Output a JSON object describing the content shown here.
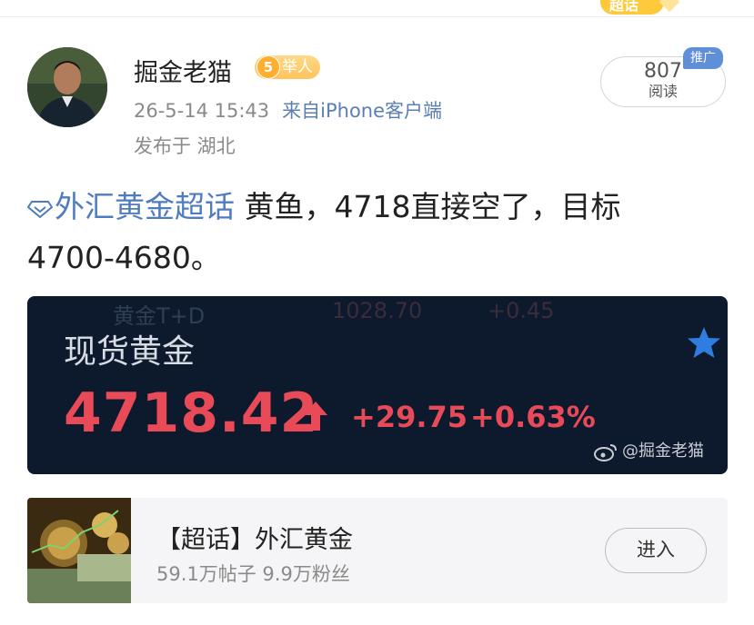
{
  "corner_badge": "超话",
  "user": {
    "name": "掘金老猫",
    "level": "5",
    "badge_label": "举人",
    "timestamp": "26-5-14 15:43",
    "source": "来自iPhone客户端",
    "location": "发布于 湖北"
  },
  "reads": {
    "count": "807",
    "label": "阅读",
    "ad_tag": "推广"
  },
  "post": {
    "topic": "外汇黄金超话",
    "text_line1": " 黄鱼，4718直接空了，目标",
    "text_line2": "4700-4680。"
  },
  "quote_card": {
    "ghost_name": "黄金T+D",
    "ghost_price": "1028.70",
    "ghost_change": "+0.45",
    "title": "现货黄金",
    "price": "4718.42",
    "change": "+29.75",
    "change_pct": "+0.63%",
    "watermark": "@掘金老猫",
    "up_color": "#e84b57",
    "star_color": "#2f7de1",
    "icons": [
      "star-icon",
      "up-arrow-icon",
      "weibo-logo-icon"
    ]
  },
  "topic_card": {
    "title": "【超话】外汇黄金",
    "stats": "59.1万帖子 9.9万粉丝",
    "enter_label": "进入"
  }
}
